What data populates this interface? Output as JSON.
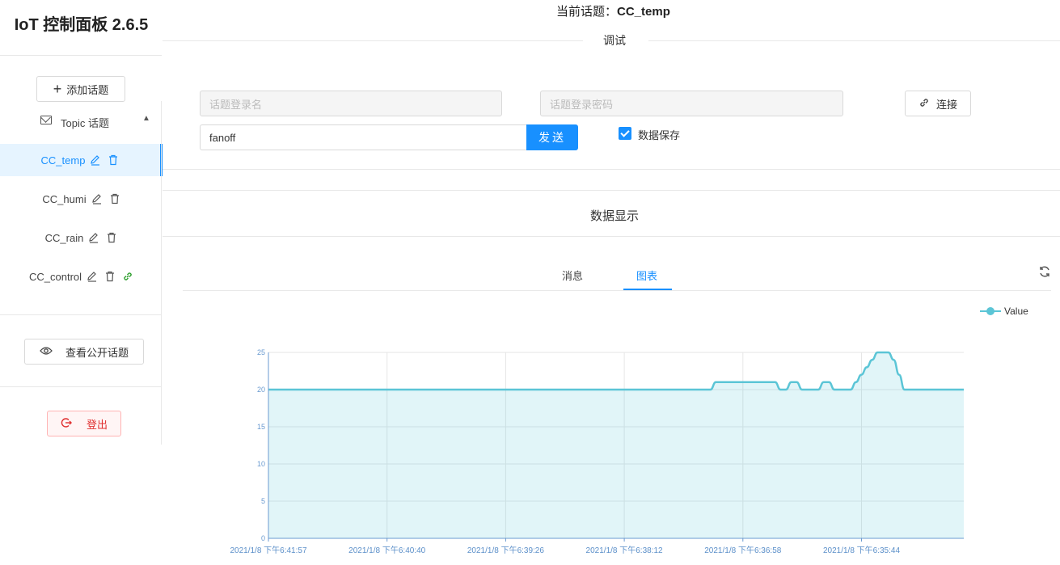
{
  "app": {
    "title": "IoT 控制面板 2.6.5"
  },
  "sidebar": {
    "add_topic_label": "添加话题",
    "topic_group_label": "Topic 话题",
    "topics": [
      {
        "name": "CC_temp",
        "active": true,
        "linked": false
      },
      {
        "name": "CC_humi",
        "active": false,
        "linked": false
      },
      {
        "name": "CC_rain",
        "active": false,
        "linked": false
      },
      {
        "name": "CC_control",
        "active": false,
        "linked": true
      }
    ],
    "view_public_label": "查看公开话题",
    "logout_label": "登出"
  },
  "header": {
    "current_topic_prefix": "当前话题：",
    "current_topic": "CC_temp"
  },
  "debug": {
    "title": "调试",
    "username_placeholder": "话题登录名",
    "password_placeholder": "话题登录密码",
    "connect_label": "连接",
    "message_value": "fanoff",
    "send_label": "发送",
    "save_label": "数据保存",
    "save_checked": true
  },
  "display": {
    "title": "数据显示",
    "tabs": [
      {
        "label": "消息",
        "active": false
      },
      {
        "label": "图表",
        "active": true
      }
    ]
  },
  "colors": {
    "accent": "#1890ff",
    "series": "#5bc5d6",
    "danger": "#e03030"
  },
  "chart_data": {
    "type": "area",
    "title": "",
    "xlabel": "",
    "ylabel": "",
    "ylim": [
      0,
      25
    ],
    "yticks": [
      0,
      5,
      10,
      15,
      20,
      25
    ],
    "xtick_labels": [
      "2021/1/8 下午6:41:57",
      "2021/1/8 下午6:40:40",
      "2021/1/8 下午6:39:26",
      "2021/1/8 下午6:38:12",
      "2021/1/8 下午6:36:58",
      "2021/1/8 下午6:35:44"
    ],
    "legend": "top-right",
    "grid": true,
    "series": [
      {
        "name": "Value",
        "values": [
          20,
          20,
          20,
          20,
          20,
          20,
          20,
          20,
          20,
          20,
          20,
          20,
          20,
          20,
          20,
          20,
          20,
          20,
          20,
          20,
          20,
          20,
          20,
          20,
          20,
          20,
          20,
          20,
          20,
          20,
          20,
          20,
          20,
          20,
          20,
          20,
          20,
          20,
          20,
          20,
          20,
          20,
          20,
          20,
          20,
          20,
          20,
          20,
          20,
          20,
          20,
          20,
          20,
          20,
          20,
          20,
          20,
          20,
          20,
          20,
          20,
          20,
          20,
          20,
          20,
          20,
          20,
          20,
          20,
          20,
          20,
          20,
          20,
          20,
          20,
          20,
          20,
          20,
          20,
          20,
          20,
          20,
          20,
          21,
          21,
          21,
          21,
          21,
          21,
          21,
          21,
          21,
          21,
          21,
          21,
          20,
          20,
          21,
          21,
          20,
          20,
          20,
          20,
          21,
          21,
          20,
          20,
          20,
          20,
          21,
          22,
          23,
          24,
          25,
          25,
          25,
          24,
          22,
          20,
          20,
          20,
          20,
          20,
          20,
          20,
          20,
          20,
          20,
          20,
          20
        ]
      }
    ]
  }
}
